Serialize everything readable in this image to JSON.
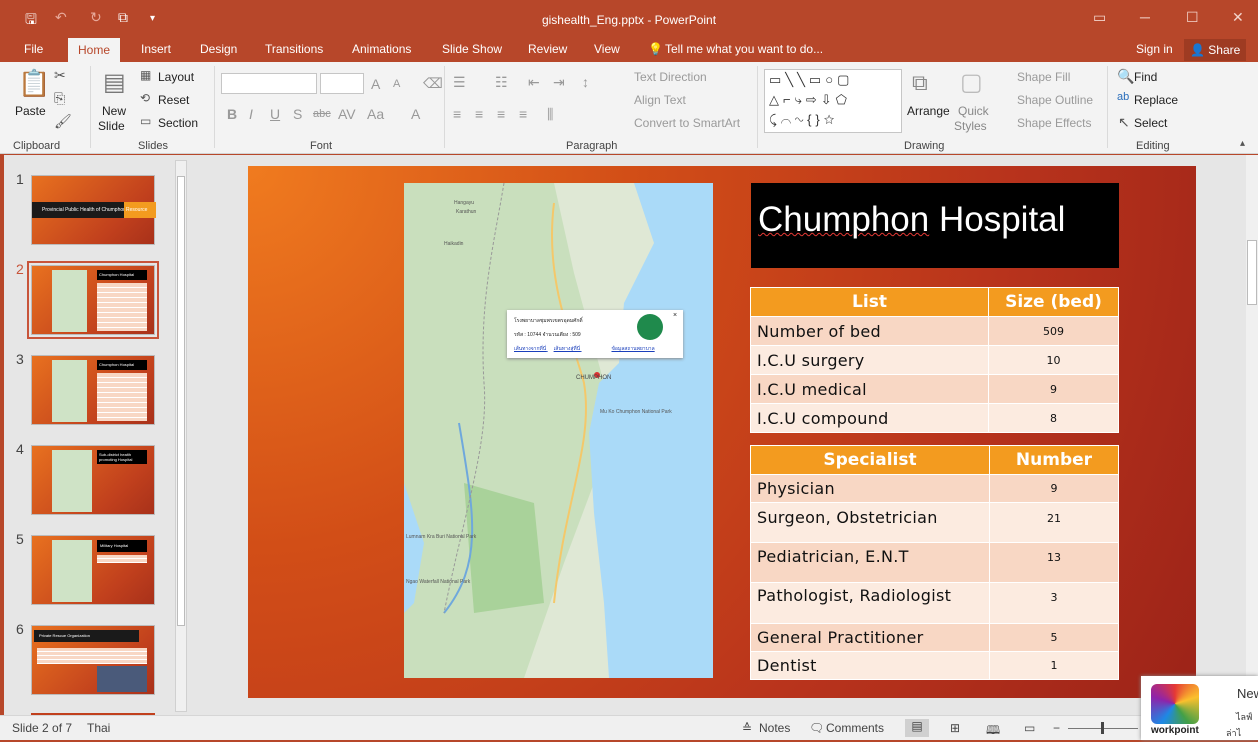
{
  "window": {
    "title": "gishealth_Eng.pptx - PowerPoint",
    "controls": {
      "minimize": "─",
      "maximize": "☐",
      "close": "✕"
    }
  },
  "tabs": [
    "File",
    "Home",
    "Insert",
    "Design",
    "Transitions",
    "Animations",
    "Slide Show",
    "Review",
    "View"
  ],
  "active_tab": "Home",
  "tell_me": "Tell me what you want to do...",
  "sign_in": "Sign in",
  "share": "Share",
  "ribbon": {
    "clipboard": {
      "paste": "Paste",
      "group": "Clipboard"
    },
    "slides": {
      "new_slide_1": "New",
      "new_slide_2": "Slide",
      "layout": "Layout",
      "reset": "Reset",
      "section": "Section",
      "group": "Slides"
    },
    "font": {
      "group": "Font"
    },
    "paragraph": {
      "text_direction": "Text Direction",
      "align_text": "Align Text",
      "convert": "Convert to SmartArt",
      "group": "Paragraph"
    },
    "drawing": {
      "arrange": "Arrange",
      "quick_styles_1": "Quick",
      "quick_styles_2": "Styles",
      "shape_fill": "Shape Fill",
      "shape_outline": "Shape Outline",
      "shape_effects": "Shape Effects",
      "group": "Drawing"
    },
    "editing": {
      "find": "Find",
      "replace": "Replace",
      "select": "Select",
      "group": "Editing"
    }
  },
  "thumbnails": [
    {
      "num": "1",
      "caption": "Provincial Public Health of Chumphon",
      "tag": "Resource"
    },
    {
      "num": "2",
      "caption": "Chumphon Hospital"
    },
    {
      "num": "3",
      "caption": "Chumphon Hospital"
    },
    {
      "num": "4",
      "caption": "Sub-district health promoting Hospital"
    },
    {
      "num": "5",
      "caption": "Military Hospital"
    },
    {
      "num": "6",
      "caption": "Private Rescue Organization"
    }
  ],
  "slide": {
    "heading_1": "Chumphon",
    "heading_2": "Hospital",
    "table1": {
      "headers": [
        "List",
        "Size (bed)"
      ],
      "rows": [
        [
          "Number of bed",
          "509"
        ],
        [
          "I.C.U surgery",
          "10"
        ],
        [
          "I.C.U medical",
          "9"
        ],
        [
          "I.C.U compound",
          "8"
        ]
      ]
    },
    "table2": {
      "headers": [
        "Specialist",
        "Number"
      ],
      "rows": [
        [
          "Physician",
          "9"
        ],
        [
          "Surgeon, Obstetrician",
          "21"
        ],
        [
          "Pediatrician, E.N.T",
          "13"
        ],
        [
          "Pathologist,  Radiologist",
          "3"
        ],
        [
          "General Practitioner",
          "5"
        ],
        [
          "Dentist",
          "1"
        ]
      ]
    },
    "map": {
      "labels": [
        "Hangayu",
        "Karathun",
        "Haikadin",
        "CHUMPHON",
        "Mu Ko Chumphon National Park",
        "Lumnam Kra Buri National Park",
        "Ngao Waterfall National Park"
      ],
      "popup_title": "โรงพยาบาลชุมพรเขตรอุดมศักดิ์",
      "popup_line": "รหัส : 10744  จำนวนเตียง : 509",
      "popup_link1": "เส้นทางจากที่นี่",
      "popup_link2": "เส้นทางสู่ที่นี่",
      "popup_link3": "ข้อมูลสถานพยาบาล",
      "popup_close": "×"
    }
  },
  "status": {
    "slide_of": "Slide 2 of 7",
    "language": "Thai",
    "notes": "Notes",
    "comments": "Comments"
  },
  "notification": {
    "brand": "workpoint",
    "text": "New",
    "line2": "ไลฟ์",
    "line3": "ล่าไ"
  }
}
